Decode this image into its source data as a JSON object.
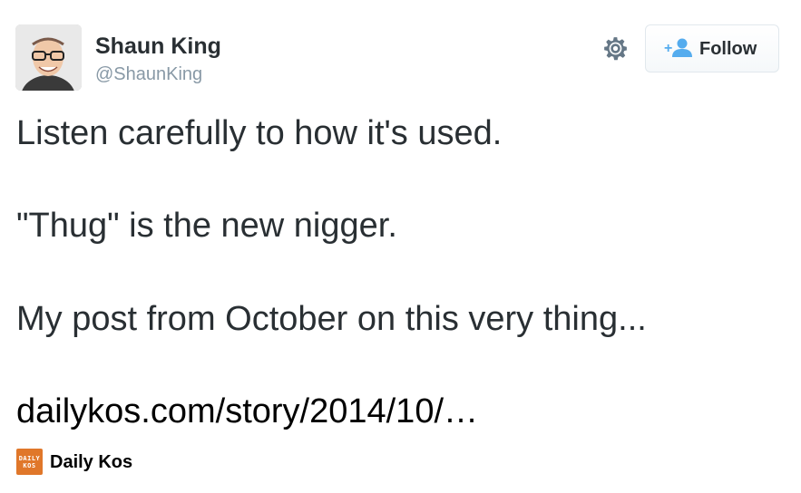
{
  "header": {
    "display_name": "Shaun King",
    "handle": "@ShaunKing",
    "avatar_icon": "user-avatar-photo",
    "settings_icon": "gear-icon",
    "follow_label": "Follow",
    "follow_icon": "add-user-icon"
  },
  "tweet": {
    "lines": [
      "Listen carefully to how it's used.",
      "\"Thug\" is the new nigger.",
      "My post from October on this very thing...",
      "dailykos.com/story/2014/10/…"
    ]
  },
  "source": {
    "logo_text_top": "DAILY",
    "logo_text_bottom": "KOS",
    "name": "Daily Kos"
  },
  "colors": {
    "text": "#292f33",
    "handle": "#8899a6",
    "follow_icon": "#55acee",
    "source_logo": "#e0772a"
  }
}
